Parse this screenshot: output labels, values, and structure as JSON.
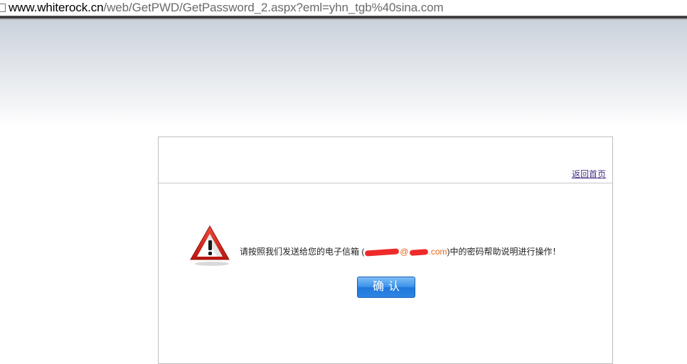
{
  "browser": {
    "url_host": "www.whiterock.cn",
    "url_path": "/web/GetPWD/GetPassword_2.aspx?eml=yhn_tgb%40sina.com",
    "page_icon": "page-icon"
  },
  "card": {
    "home_link": "返回首页",
    "warning_icon": "warning-triangle-icon",
    "message_before": "请按照我们发送给您的电子信箱 (",
    "email_at": "@",
    "email_suffix": ".com",
    "message_after": ")中的密码帮助说明进行操作！",
    "confirm_label": "确认"
  },
  "colors": {
    "link": "#4b2f86",
    "email": "#e8661c",
    "button": "#2d86e3",
    "warning_red": "#d9261c"
  }
}
